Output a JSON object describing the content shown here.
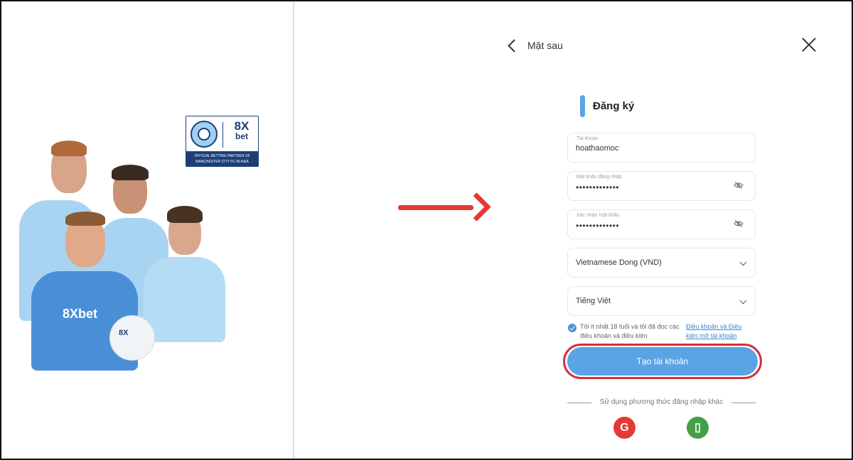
{
  "banner": {
    "sponsor_brand_top": "8X",
    "sponsor_brand_bottom": "bet",
    "sponsor_caption": "OFFICIAL BETTING PARTNER OF MANCHESTER CITY FC IN ASIA",
    "shirt_text": "8Xbet",
    "ball_text": "8X"
  },
  "nav": {
    "back_label": "Mặt sau"
  },
  "form": {
    "title": "Đăng ký",
    "username": {
      "label": "Tài khoản",
      "value": "hoathaomoc"
    },
    "password": {
      "label": "Mật khẩu đăng nhập",
      "value": "•••••••••••••"
    },
    "confirm_password": {
      "label": "Xác nhận mật khẩu",
      "value": "•••••••••••••"
    },
    "currency": {
      "value": "Vietnamese Dong (VND)"
    },
    "language": {
      "value": "Tiếng Việt"
    },
    "consent_text": "Tôi ít nhất 18 tuổi và tôi đã đọc các điều khoản và điều kiện",
    "consent_link": "Điều khoản và Điều kiện mở tài khoản",
    "consent_checked": true,
    "submit_label": "Tạo tài khoản",
    "alt_login_text": "Sử dụng phương thức đăng nhập khác",
    "google_glyph": "G",
    "phone_glyph": "▯"
  },
  "colors": {
    "accent": "#5aa4e6",
    "annotation_red": "#e53935",
    "google": "#e53935",
    "phone": "#43a047"
  }
}
